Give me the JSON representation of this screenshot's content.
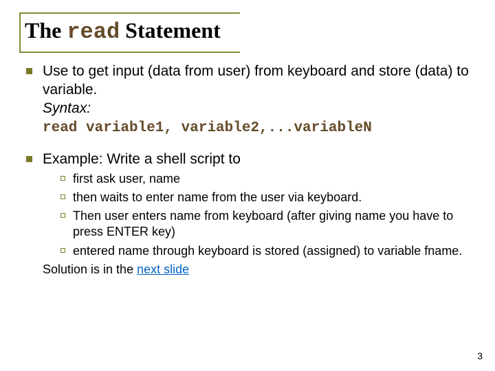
{
  "title": {
    "prefix": "The ",
    "code": "read",
    "suffix": " Statement"
  },
  "bullet1": {
    "line1": "Use to get input (data from user) from keyboard and store (data) to variable.",
    "syntax_label": "Syntax:",
    "code": "read variable1, variable2,...variableN"
  },
  "bullet2": {
    "intro": "Example: Write a shell script to",
    "subs": {
      "a": "first ask user, name",
      "b": "then waits to enter name from the user via keyboard.",
      "c": "Then user enters name from keyboard (after giving name you have to press ENTER key)",
      "d": "entered name through keyboard is stored (assigned) to variable fname."
    },
    "solution_prefix": "Solution is in the ",
    "solution_link": "next slide"
  },
  "page_number": "3"
}
